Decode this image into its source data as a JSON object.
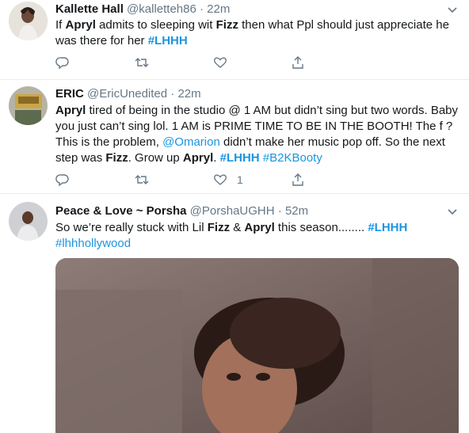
{
  "tweets": [
    {
      "name": "Kallette Hall",
      "handle": "@kalletteh86",
      "sep": "·",
      "time": "22m",
      "text": [
        {
          "t": "If ",
          "s": "plain"
        },
        {
          "t": "Apryl",
          "s": "bold"
        },
        {
          "t": " admits to sleeping wit ",
          "s": "plain"
        },
        {
          "t": "Fizz",
          "s": "bold"
        },
        {
          "t": " then what Ppl should just appreciate he was there for her ",
          "s": "plain"
        },
        {
          "t": "#LHHH",
          "s": "link-bold"
        }
      ],
      "likes": "",
      "retweets": "",
      "replies": ""
    },
    {
      "name": "ERIC",
      "handle": "@EricUnedited",
      "sep": "·",
      "time": "22m",
      "text": [
        {
          "t": "Apryl",
          "s": "bold"
        },
        {
          "t": " tired of being in the studio @ 1 AM but didn’t sing but two words. Baby you just can’t sing lol. 1 AM is PRIME TIME TO BE IN THE BOOTH! The f     ? This is the problem, ",
          "s": "plain"
        },
        {
          "t": "@Omarion",
          "s": "link"
        },
        {
          "t": " didn’t make her music pop off. So the next step was ",
          "s": "plain"
        },
        {
          "t": "Fizz",
          "s": "bold"
        },
        {
          "t": ". Grow up ",
          "s": "plain"
        },
        {
          "t": "Apryl",
          "s": "bold"
        },
        {
          "t": ". ",
          "s": "plain"
        },
        {
          "t": "#LHHH",
          "s": "link-bold"
        },
        {
          "t": " ",
          "s": "plain"
        },
        {
          "t": "#B2KBooty",
          "s": "link"
        }
      ],
      "likes": "1",
      "retweets": "",
      "replies": ""
    },
    {
      "name": "Peace & Love ~ Porsha",
      "handle": "@PorshaUGHH",
      "sep": "·",
      "time": "52m",
      "text": [
        {
          "t": "So we’re really stuck with Lil ",
          "s": "plain"
        },
        {
          "t": "Fizz",
          "s": "bold"
        },
        {
          "t": " & ",
          "s": "plain"
        },
        {
          "t": "Apryl",
          "s": "bold"
        },
        {
          "t": " this season........ ",
          "s": "plain"
        },
        {
          "t": "#LHHH",
          "s": "link-bold"
        },
        {
          "t": " ",
          "s": "plain"
        },
        {
          "t": "#lhhhollywood",
          "s": "link"
        }
      ],
      "likes": "",
      "retweets": "",
      "replies": ""
    }
  ],
  "colors": {
    "text": "#14171a",
    "muted": "#657786",
    "link": "#1b95e0",
    "divider": "#e6ecf0"
  },
  "icons": [
    "reply-icon",
    "retweet-icon",
    "like-icon",
    "share-icon",
    "chevron-down-icon"
  ]
}
